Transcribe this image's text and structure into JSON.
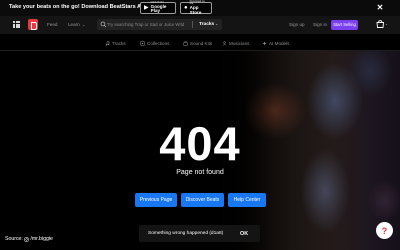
{
  "promo": {
    "text": "Take your beats on the go! Download BeatStars App",
    "google_play": {
      "small": "GET IT ON",
      "big": "Google Play"
    },
    "app_store": {
      "small": "Download on the",
      "big": "App Store"
    },
    "close": "✕"
  },
  "header": {
    "nav": {
      "feed": "Feed",
      "learn": "Learn"
    },
    "search": {
      "placeholder": "Try searching Trap or Sad or Juice Wrld",
      "category": "Tracks"
    },
    "sign_up": "Sign up",
    "sign_in": "Sign in",
    "start_selling": "Start Selling"
  },
  "subnav": {
    "items": [
      {
        "label": "Tracks",
        "icon": "music-note-icon"
      },
      {
        "label": "Collections",
        "icon": "collections-icon"
      },
      {
        "label": "Sound Kits",
        "icon": "sound-kit-icon"
      },
      {
        "label": "Musicians",
        "icon": "musicians-icon"
      },
      {
        "label": "AI Models",
        "icon": "ai-models-icon"
      }
    ]
  },
  "error": {
    "code": "404",
    "message": "Page not found",
    "buttons": {
      "previous": "Previous Page",
      "discover": "Discover Beats",
      "help": "Help Center"
    }
  },
  "source": {
    "prefix": "Source:",
    "handle": "/mr.biggie"
  },
  "toast": {
    "text": "Something wrong happened (d1a8)",
    "ok": "OK"
  },
  "help_fab": "?",
  "colors": {
    "brand_red": "#e8383d",
    "accent_purple": "#7b3ff2",
    "button_blue": "#1877f2"
  }
}
